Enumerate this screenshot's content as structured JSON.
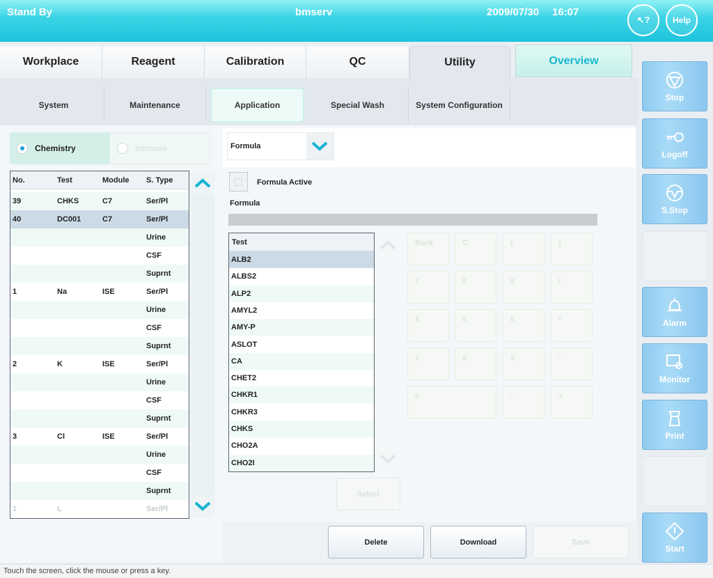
{
  "header": {
    "status": "Stand By",
    "user": "bmserv",
    "date": "2009/07/30",
    "time": "16:07",
    "help_pointer_label": "?",
    "help_label": "Help"
  },
  "tabs": [
    {
      "label": "Workplace"
    },
    {
      "label": "Reagent"
    },
    {
      "label": "Calibration"
    },
    {
      "label": "QC"
    },
    {
      "label": "Utility",
      "active": true
    },
    {
      "label": "Overview"
    }
  ],
  "subtabs": [
    {
      "label": "System"
    },
    {
      "label": "Maintenance"
    },
    {
      "label": "Application",
      "active": true
    },
    {
      "label": "Special Wash"
    },
    {
      "label": "System Configuration"
    }
  ],
  "sidebar": [
    {
      "label": "Stop",
      "icon": "stop-icon"
    },
    {
      "label": "Logoff",
      "icon": "key-icon"
    },
    {
      "label": "S.Stop",
      "icon": "sampling-stop-icon"
    },
    {
      "label": ""
    },
    {
      "label": "Alarm",
      "icon": "bell-icon"
    },
    {
      "label": "Monitor",
      "icon": "monitor-icon"
    },
    {
      "label": "Print",
      "icon": "print-icon"
    },
    {
      "label": ""
    },
    {
      "label": "Start",
      "icon": "start-icon"
    }
  ],
  "module_radio": {
    "chemistry": "Chemistry",
    "immune": "Immune",
    "selected": "Chemistry"
  },
  "test_table": {
    "headers": [
      "No.",
      "Test",
      "Module",
      "S. Type"
    ],
    "rows": [
      [
        "39",
        "CHKS",
        "C7",
        "Ser/Pl"
      ],
      [
        "40",
        "DC001",
        "C7",
        "Ser/Pl"
      ],
      [
        "",
        "",
        "",
        "Urine"
      ],
      [
        "",
        "",
        "",
        "CSF"
      ],
      [
        "",
        "",
        "",
        "Suprnt"
      ],
      [
        "1",
        "Na",
        "ISE",
        "Ser/Pl"
      ],
      [
        "",
        "",
        "",
        "Urine"
      ],
      [
        "",
        "",
        "",
        "CSF"
      ],
      [
        "",
        "",
        "",
        "Suprnt"
      ],
      [
        "2",
        "K",
        "ISE",
        "Ser/Pl"
      ],
      [
        "",
        "",
        "",
        "Urine"
      ],
      [
        "",
        "",
        "",
        "CSF"
      ],
      [
        "",
        "",
        "",
        "Suprnt"
      ],
      [
        "3",
        "Cl",
        "ISE",
        "Ser/Pl"
      ],
      [
        "",
        "",
        "",
        "Urine"
      ],
      [
        "",
        "",
        "",
        "CSF"
      ],
      [
        "",
        "",
        "",
        "Suprnt"
      ],
      [
        "1",
        "L",
        "",
        "Ser/Pl"
      ]
    ],
    "selected_row": 1
  },
  "view_select": {
    "value": "Formula"
  },
  "formula_active": {
    "label": "Formula Active",
    "checked": false
  },
  "formula": {
    "label": "Formula",
    "value": ""
  },
  "formula_tests": {
    "header": "Test",
    "items": [
      "ALB2",
      "ALBS2",
      "ALP2",
      "AMYL2",
      "AMY-P",
      "ASLOT",
      "CA",
      "CHET2",
      "CHKR1",
      "CHKR3",
      "CHKS",
      "CHO2A",
      "CHO2I"
    ],
    "selected": 0
  },
  "keypad": [
    [
      "Back",
      "C",
      "(",
      ")"
    ],
    [
      "7",
      "8",
      "9",
      "/"
    ],
    [
      "4",
      "5",
      "6",
      "*"
    ],
    [
      "1",
      "2",
      "3",
      "-"
    ],
    [
      "0",
      ".",
      "+"
    ]
  ],
  "select_button": "Select",
  "actions": {
    "delete": "Delete",
    "download": "Download",
    "save": "Save"
  },
  "status_bar": "Touch the screen, click the mouse or press a key.",
  "colors": {
    "header": "#1bc3dc",
    "accent": "#16b8cf",
    "side_button": "#a9dbf7",
    "selected_row": "#ccdae6"
  }
}
